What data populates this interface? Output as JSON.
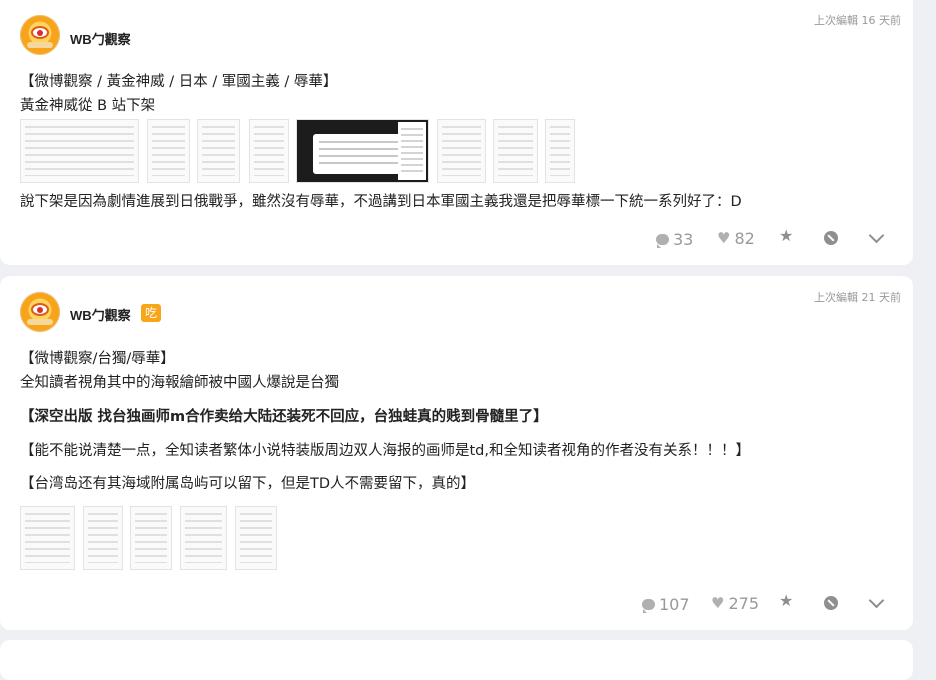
{
  "posts": [
    {
      "username": "WB勹觀察",
      "timestamp": "上次編輯 16 天前",
      "tags_line": "【微博觀察 / 黃金神威 / 日本 / 軍國主義 / 辱華】",
      "headline": "黃金神威從 B 站下架",
      "body": "說下架是因為劇情進展到日俄戰爭，雖然沒有辱華，不過講到日本軍國主義我還是把辱華標一下統一系列好了：D",
      "comments": "33",
      "likes": "82"
    },
    {
      "username": "WB勹觀察",
      "badge": "吃",
      "timestamp": "上次編輯 21 天前",
      "tags_line": "【微博觀察/台獨/辱華】",
      "headline": "全知讀者視角其中的海報繪師被中國人爆說是台獨",
      "quote1": "【深空出版 找台独画师m合作卖给大陆还装死不回应，台独蛙真的贱到骨髓里了】",
      "quote2": "【能不能说清楚一点，全知读者繁体小说特装版周边双人海报的画师是td,和全知读者视角的作者没有关系！！！】",
      "quote3": "【台湾岛还有其海域附属岛屿可以留下，但是TD人不需要留下，真的】",
      "comments": "107",
      "likes": "275"
    }
  ],
  "icons": {
    "comment": "comment-icon",
    "like": "heart-icon",
    "favorite": "star-icon",
    "block": "block-icon",
    "more": "chevron-down-icon"
  },
  "colors": {
    "background": "#eef0f4",
    "card": "#ffffff",
    "badge": "#f9a51a",
    "muted": "#999999"
  }
}
